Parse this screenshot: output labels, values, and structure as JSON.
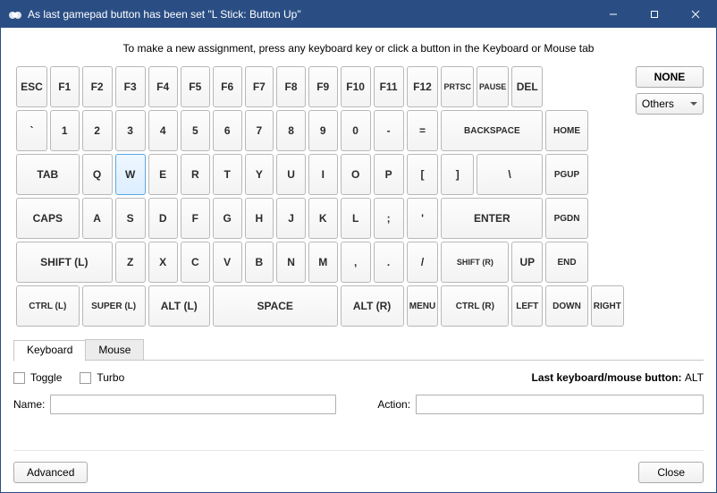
{
  "window": {
    "title": "As last gamepad button has been set \"L Stick: Button Up\"",
    "minimize": "–",
    "maximize": "▢",
    "close": "✕"
  },
  "instruction": "To make a new assignment, press any keyboard key or click a button in the Keyboard or Mouse tab",
  "side": {
    "none": "NONE",
    "others": "Others"
  },
  "keyboard": {
    "row1": [
      "ESC",
      "F1",
      "F2",
      "F3",
      "F4",
      "F5",
      "F6",
      "F7",
      "F8",
      "F9",
      "F10",
      "F11",
      "F12",
      "PRTSC",
      "PAUSE",
      "DEL"
    ],
    "row2": [
      "`",
      "1",
      "2",
      "3",
      "4",
      "5",
      "6",
      "7",
      "8",
      "9",
      "0",
      "-",
      "=",
      "BACKSPACE",
      "HOME"
    ],
    "row3": [
      "TAB",
      "Q",
      "W",
      "E",
      "R",
      "T",
      "Y",
      "U",
      "I",
      "O",
      "P",
      "[",
      "]",
      "\\",
      "PGUP"
    ],
    "row4": [
      "CAPS",
      "A",
      "S",
      "D",
      "F",
      "G",
      "H",
      "J",
      "K",
      "L",
      ";",
      "'",
      "ENTER",
      "PGDN"
    ],
    "row5": [
      "SHIFT (L)",
      "Z",
      "X",
      "C",
      "V",
      "B",
      "N",
      "M",
      ",",
      ".",
      "/",
      "SHIFT (R)",
      "UP",
      "END"
    ],
    "row6": [
      "CTRL (L)",
      "SUPER (L)",
      "ALT (L)",
      "SPACE",
      "ALT (R)",
      "MENU",
      "CTRL (R)",
      "LEFT",
      "DOWN",
      "RIGHT"
    ]
  },
  "tabs": {
    "keyboard": "Keyboard",
    "mouse": "Mouse"
  },
  "opts": {
    "toggle": "Toggle",
    "turbo": "Turbo",
    "last_label": "Last keyboard/mouse button:",
    "last_value": "ALT"
  },
  "form": {
    "name_label": "Name:",
    "name_value": "",
    "action_label": "Action:",
    "action_value": ""
  },
  "footer": {
    "advanced": "Advanced",
    "close": "Close"
  },
  "selected_key": "W"
}
